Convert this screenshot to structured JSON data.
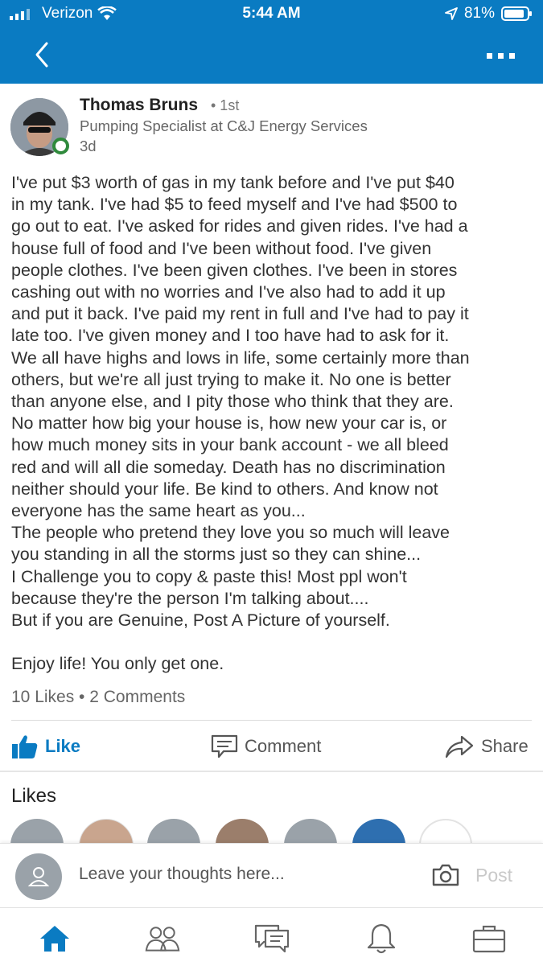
{
  "status_bar": {
    "carrier": "Verizon",
    "time": "5:44 AM",
    "battery": "81%"
  },
  "post": {
    "author_name": "Thomas Bruns",
    "connection_degree": "• 1st",
    "headline": "Pumping Specialist at C&J Energy Services",
    "time_ago": "3d",
    "lines": [
      "I've put $3 worth of gas in my tank before and I've put $40",
      "in my tank. I've had $5 to feed myself and I've had $500 to",
      "go out to eat.  I've asked for rides and given rides. I've had a",
      "house full of food and I've been without food. I've given",
      "people clothes. I've been given clothes. I've been in stores",
      "cashing out with no worries and I've also had to add it up",
      "and put it back. I've paid my rent in full and I've had to pay it",
      "late too. I've given money and I too have had to ask for it.",
      "We all have highs and lows in life, some certainly more than",
      "others, but we're all just trying to make it. No one is better",
      "than anyone else, and I pity those who think that they are.",
      "No matter how big your house is, how new your car is, or",
      "how much money sits in your bank account - we all bleed",
      "red and will all die someday. Death has no discrimination",
      "neither should your life. Be kind to others. And know not",
      "everyone has the same heart as you...",
      "The people who pretend they love you so much will leave",
      "you standing in all the storms just so they can shine...",
      "I Challenge you to copy & paste this!  Most ppl won't",
      "because they're the person I'm talking about....",
      "But if you are Genuine, Post A Picture of yourself.",
      "",
      "Enjoy life! You only get one."
    ],
    "stats": "10 Likes • 2 Comments"
  },
  "actions": {
    "like": "Like",
    "comment": "Comment",
    "share": "Share"
  },
  "likes_section": {
    "title": "Likes"
  },
  "composer": {
    "placeholder": "Leave your thoughts here...",
    "post_label": "Post"
  },
  "colors": {
    "brand": "#0a7bc2",
    "like_blue": "#0a7bc2",
    "online_green": "#2f8a3c"
  },
  "tabs": [
    "home-icon",
    "my-network-icon",
    "messaging-icon",
    "notifications-icon",
    "jobs-icon"
  ]
}
